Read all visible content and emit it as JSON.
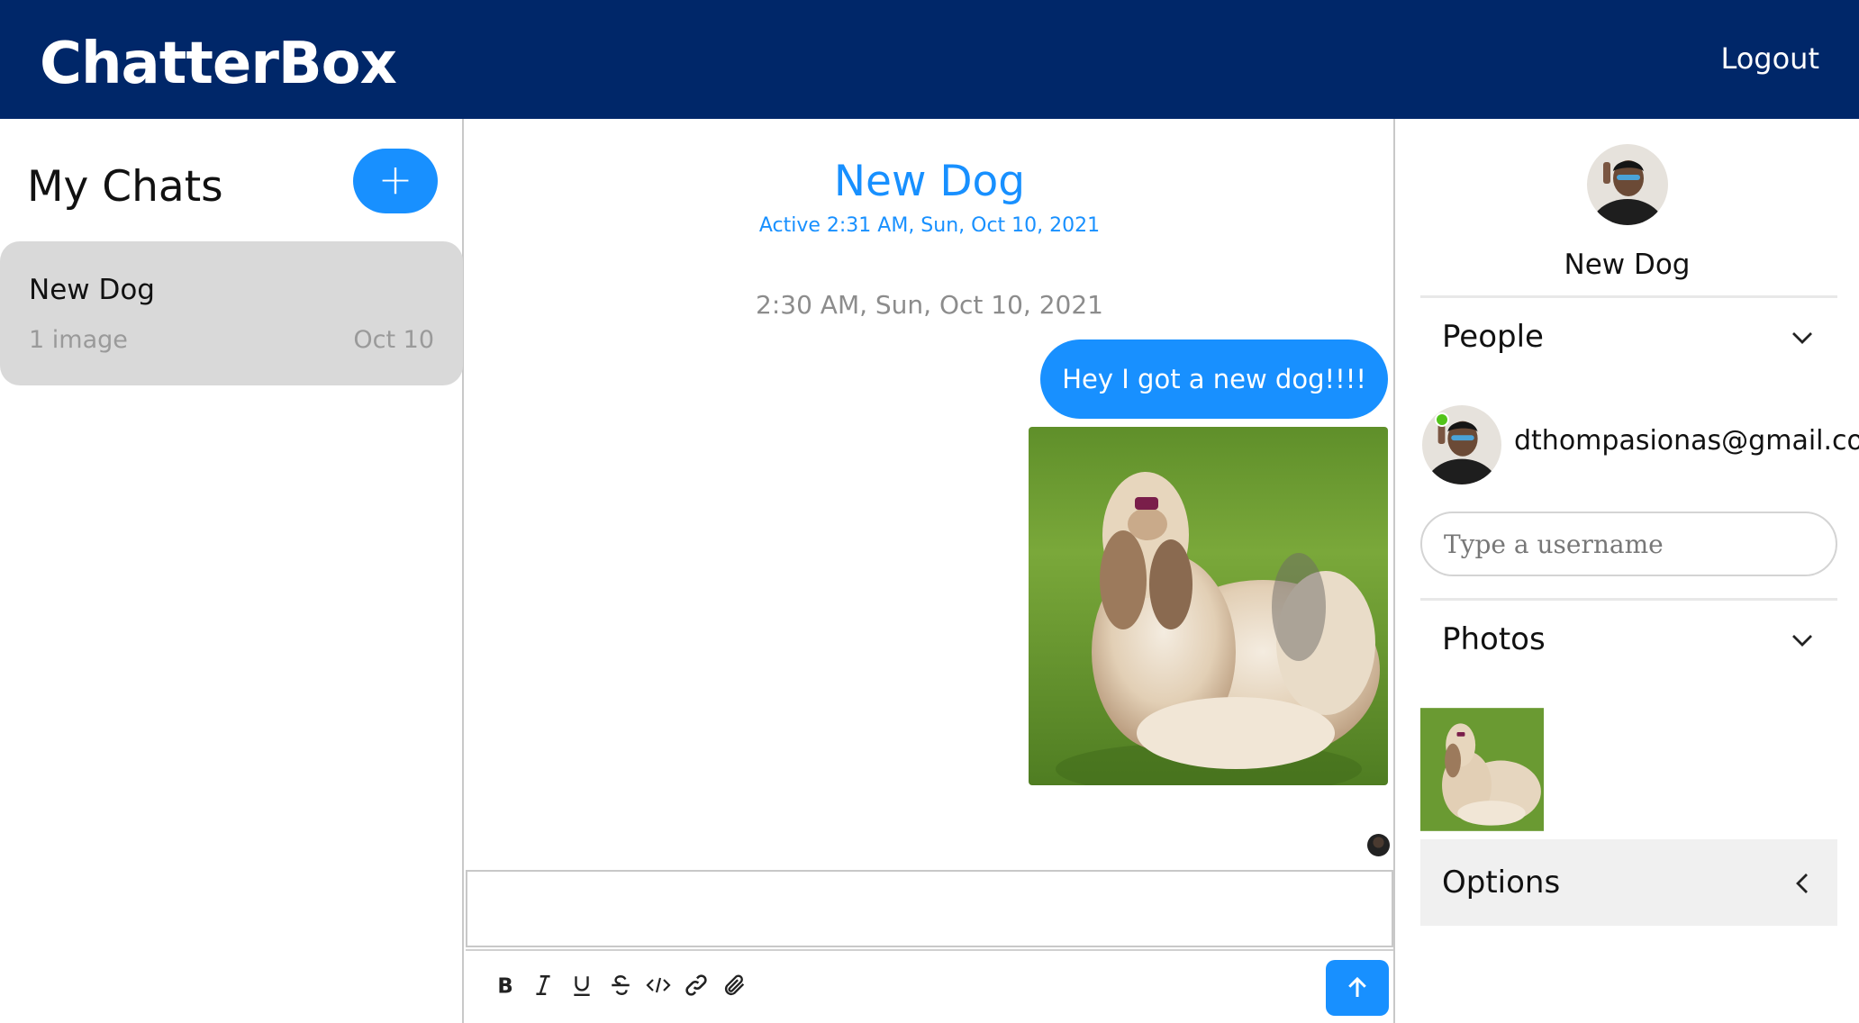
{
  "header": {
    "brand": "ChatterBox",
    "logout_label": "Logout",
    "background_color": "#002769"
  },
  "sidebar": {
    "title": "My Chats",
    "add_button_label": "+",
    "chats": [
      {
        "title": "New Dog",
        "preview": "1 image",
        "date": "Oct 10"
      }
    ]
  },
  "feed": {
    "title": "New Dog",
    "subtitle": "Active 2:31 AM, Sun, Oct 10, 2021",
    "timestamp": "2:30 AM, Sun, Oct 10, 2021",
    "messages": [
      {
        "text": "Hey I got a new dog!!!!"
      }
    ],
    "toolbar": [
      "bold-icon",
      "italic-icon",
      "underline-icon",
      "strikethrough-icon",
      "code-icon",
      "link-icon",
      "attachment-icon"
    ],
    "accent_color": "#1890ff"
  },
  "settings": {
    "chat_title": "New Dog",
    "sections": {
      "people": "People",
      "photos": "Photos",
      "options": "Options"
    },
    "people": [
      {
        "email": "dthompasionas@gmail.com",
        "online": true
      }
    ],
    "username_placeholder": "Type a username",
    "online_color": "#52c41a"
  }
}
